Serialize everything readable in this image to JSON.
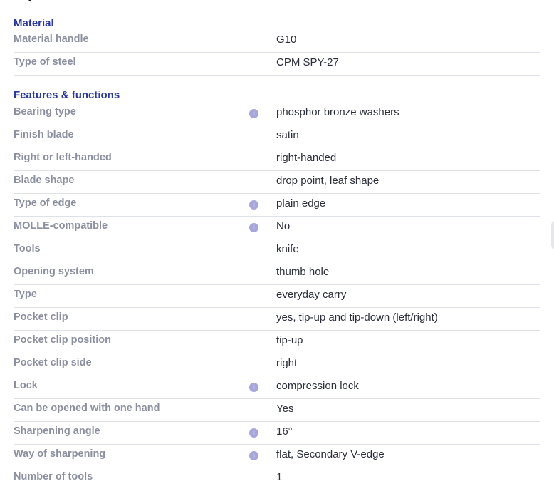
{
  "sections": [
    {
      "title": "Material",
      "rows": [
        {
          "label": "Material handle",
          "value": "G10",
          "info": false
        },
        {
          "label": "Type of steel",
          "value": "CPM SPY-27",
          "info": false
        }
      ]
    },
    {
      "title": "Features & functions",
      "rows": [
        {
          "label": "Bearing type",
          "value": "phosphor bronze washers",
          "info": true
        },
        {
          "label": "Finish blade",
          "value": "satin",
          "info": false
        },
        {
          "label": "Right or left-handed",
          "value": "right-handed",
          "info": false
        },
        {
          "label": "Blade shape",
          "value": "drop point, leaf shape",
          "info": false
        },
        {
          "label": "Type of edge",
          "value": "plain edge",
          "info": true
        },
        {
          "label": "MOLLE-compatible",
          "value": "No",
          "info": true
        },
        {
          "label": "Tools",
          "value": "knife",
          "info": false
        },
        {
          "label": "Opening system",
          "value": "thumb hole",
          "info": false
        },
        {
          "label": "Type",
          "value": "everyday carry",
          "info": false
        },
        {
          "label": "Pocket clip",
          "value": "yes, tip-up and tip-down (left/right)",
          "info": false
        },
        {
          "label": "Pocket clip position",
          "value": "tip-up",
          "info": false
        },
        {
          "label": "Pocket clip side",
          "value": "right",
          "info": false
        },
        {
          "label": "Lock",
          "value": "compression lock",
          "info": true
        },
        {
          "label": "Can be opened with one hand",
          "value": "Yes",
          "info": false
        },
        {
          "label": "Sharpening angle",
          "value": "16°",
          "info": true
        },
        {
          "label": "Way of sharpening",
          "value": "flat, Secondary V-edge",
          "info": true
        },
        {
          "label": "Number of tools",
          "value": "1",
          "info": false
        }
      ]
    }
  ],
  "icons": {
    "info": "info-icon",
    "info_glyph": "i"
  },
  "colors": {
    "section_title": "#2b3a99",
    "label": "#8b8f9f",
    "value": "#2c2f3a",
    "divider": "#dfe1e9",
    "info_icon": "#a6a6db"
  }
}
